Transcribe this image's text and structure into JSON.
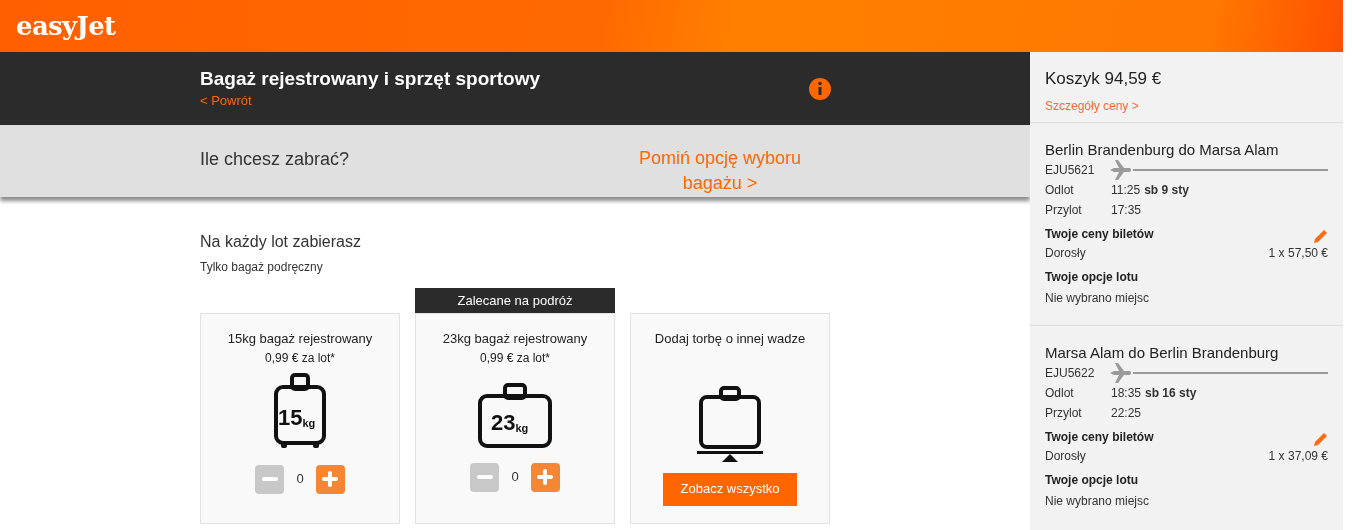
{
  "header": {
    "logo": "easyJet"
  },
  "page_title": "Bagaż rejestrowany i sprzęt sportowy",
  "back_link": "< Powrót",
  "question": "Ile chcesz zabrać?",
  "skip_link": "Pomiń opcję wyboru bagażu >",
  "section": {
    "title": "Na każdy lot zabierasz",
    "subtitle": "Tylko bagaż podręczny"
  },
  "options": [
    {
      "kind": "counter",
      "icon_weight": "15",
      "icon_unit": "kg",
      "title": "15kg bagaż rejestrowany",
      "price": "0,99 € za lot*",
      "count": "0",
      "minus_disabled": true
    },
    {
      "kind": "counter",
      "badge": "Zalecane na podróż",
      "icon_weight": "23",
      "icon_unit": "kg",
      "title": "23kg bagaż rejestrowany",
      "price": "0,99 € za lot*",
      "count": "0",
      "minus_disabled": true
    },
    {
      "kind": "button",
      "title": "Dodaj torbę o innej wadze",
      "button": "Zobacz wszystko"
    }
  ],
  "basket": {
    "title": "Koszyk 94,59 €",
    "details_link": "Szczegóły ceny >",
    "flights": [
      {
        "route": "Berlin Brandenburg do Marsa Alam",
        "flight_no": "EJU5621",
        "departure_label": "Odlot",
        "departure_time": "11:25",
        "departure_date": "sb 9 sty",
        "arrival_label": "Przylot",
        "arrival_time": "17:35",
        "prices_label": "Twoje ceny biletów",
        "passenger": "Dorosły",
        "price": "1 x 57,50 €",
        "options_label": "Twoje opcje lotu",
        "options_value": "Nie wybrano miejsc"
      },
      {
        "route": "Marsa Alam do Berlin Brandenburg",
        "flight_no": "EJU5622",
        "departure_label": "Odlot",
        "departure_time": "18:35",
        "departure_date": "sb 16 sty",
        "arrival_label": "Przylot",
        "arrival_time": "22:25",
        "prices_label": "Twoje ceny biletów",
        "passenger": "Dorosły",
        "price": "1 x 37,09 €",
        "options_label": "Twoje opcje lotu",
        "options_value": "Nie wybrano miejsc"
      }
    ]
  }
}
